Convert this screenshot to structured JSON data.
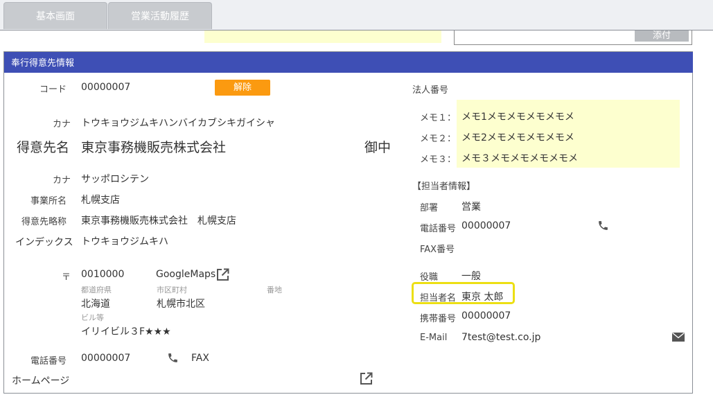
{
  "tabs": [
    "基本画面",
    "営業活動履歴"
  ],
  "attach_label": "添付",
  "panel_title": "奉行得意先情報",
  "left": {
    "code_label": "コード",
    "code_value": "00000007",
    "cancel_label": "解除",
    "kana_label": "カナ",
    "kana_value": "トウキョウジムキハンバイカブシキガイシャ",
    "name_label": "得意先名",
    "name_value": "東京事務機販売株式会社",
    "honorific": "御中",
    "office_kana_label": "カナ",
    "office_kana_value": "サッポロシテン",
    "office_label": "事業所名",
    "office_value": "札幌支店",
    "short_label": "得意先略称",
    "short_value": "東京事務機販売株式会社　札幌支店",
    "index_label": "インデックス",
    "index_value": "トウキョウジムキハ",
    "postal_label": "〒",
    "postal_value": "0010000",
    "maps_label": "GoogleMaps",
    "pref_label": "都道府県",
    "pref_value": "北海道",
    "city_label": "市区町村",
    "city_value": "札幌市北区",
    "street_label": "番地",
    "building_label": "ビル等",
    "building_value": "イリイビル３F★★★",
    "phone_label": "電話番号",
    "phone_value": "00000007",
    "fax_label": "FAX",
    "homepage_label": "ホームページ"
  },
  "right": {
    "corp_label": "法人番号",
    "memos": [
      {
        "label": "メモ１：",
        "value": "メモ1メモメモメモメモメ"
      },
      {
        "label": "メモ２：",
        "value": "メモ2メモメモメモメモメ"
      },
      {
        "label": "メモ３：",
        "value": "メモ３メモメモメモメモメ"
      }
    ],
    "contact_heading": "【担当者情報】",
    "dept_label": "部署",
    "dept_value": "営業",
    "phone_label": "電話番号",
    "phone_value": "00000007",
    "fax_label": "FAX番号",
    "title_label": "役職",
    "title_value": "一般",
    "person_label": "担当者名",
    "person_value": "東京 太郎",
    "mobile_label": "携帯番号",
    "mobile_value": "00000007",
    "email_label": "E-Mail",
    "email_value": "7test@test.co.jp"
  },
  "colors": {
    "header_bg": "#3e4fb5",
    "cancel_bg": "#fb9a10",
    "memo_bg": "#fdffcf",
    "highlight": "#ecdf13"
  },
  "icons": [
    "external-link-icon",
    "phone-icon",
    "mail-icon"
  ]
}
